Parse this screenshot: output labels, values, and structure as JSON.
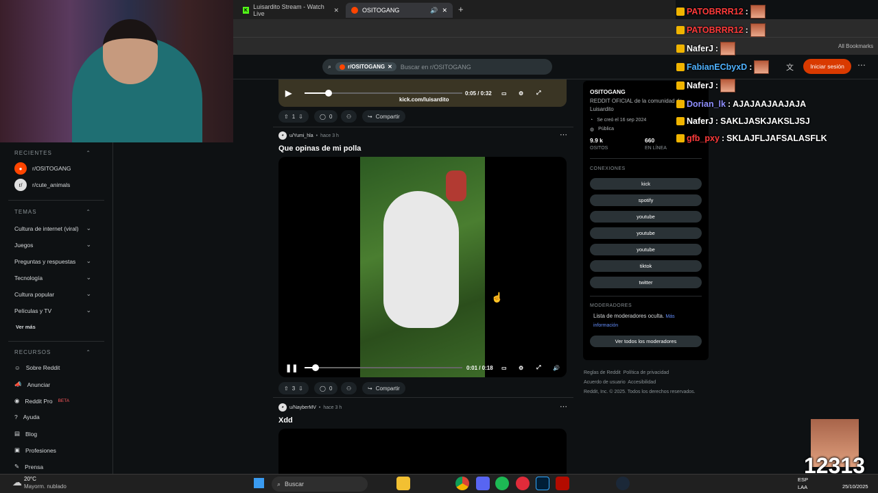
{
  "browser": {
    "tabs": [
      {
        "label": "Luisardito Stream - Watch Live"
      },
      {
        "label": "OSITOGANG"
      }
    ],
    "bookmarks_label": "All Bookmarks"
  },
  "reddit": {
    "search_chip": "r/OSITOGANG",
    "search_placeholder": "Buscar en r/OSITOGANG",
    "login_label": "Iniciar sesión"
  },
  "sidebar": {
    "recientes_title": "RECIENTES",
    "recientes": [
      {
        "label": "r/OSITOGANG"
      },
      {
        "label": "r/cute_animals"
      }
    ],
    "temas_title": "TEMAS",
    "temas": [
      {
        "label": "Cultura de internet (viral)"
      },
      {
        "label": "Juegos"
      },
      {
        "label": "Preguntas y respuestas"
      },
      {
        "label": "Tecnología"
      },
      {
        "label": "Cultura popular"
      },
      {
        "label": "Películas y TV"
      }
    ],
    "ver_mas": "Ver más",
    "recursos_title": "RECURSOS",
    "recursos": [
      {
        "label": "Sobre Reddit"
      },
      {
        "label": "Anunciar"
      },
      {
        "label": "Reddit Pro",
        "badge": "BETA"
      },
      {
        "label": "Ayuda"
      },
      {
        "label": "Blog"
      },
      {
        "label": "Profesiones"
      },
      {
        "label": "Prensa"
      }
    ]
  },
  "feed": {
    "post0": {
      "time": "0:05 / 0:32",
      "overlay_text": "kick.com/luisardito",
      "votes": "1",
      "comments": "0",
      "share": "Compartir"
    },
    "post1": {
      "author": "u/Yumi_hla",
      "ago": "hace 3 h",
      "title": "Que opinas de mi polla",
      "time": "0:01 / 0:18",
      "progress": 0.07,
      "votes": "3",
      "comments": "0",
      "share": "Compartir"
    },
    "post2": {
      "author": "u/NayberMV",
      "ago": "hace 3 h",
      "title": "Xdd"
    }
  },
  "community": {
    "name": "OSITOGANG",
    "desc": "REDDIT OFICIAL de la comunidad de Luisardito",
    "created": "Se creó el 16 sep 2024",
    "visibility": "Pública",
    "members": "9.9 k",
    "members_label": "OSITOS",
    "online": "660",
    "online_label": "EN LÍNEA",
    "connections_title": "CONEXIONES",
    "connections": [
      {
        "label": "kick"
      },
      {
        "label": "spotify"
      },
      {
        "label": "youtube"
      },
      {
        "label": "youtube"
      },
      {
        "label": "youtube"
      },
      {
        "label": "tiktok"
      },
      {
        "label": "twitter"
      }
    ],
    "mods_title": "MODERADORES",
    "mods_text": "Lista de moderadores oculta.",
    "mods_link": "Más información",
    "mods_button": "Ver todos los moderadores",
    "footer": [
      "Reglas de Reddit",
      "Política de privacidad",
      "Acuerdo de usuario",
      "Accesibilidad",
      "Reddit, Inc. © 2025. Todos los derechos reservados."
    ]
  },
  "chat": [
    {
      "user": "PATOBRRR12",
      "msg": "",
      "color": "#ff3b3b"
    },
    {
      "user": "PATOBRRR12",
      "msg": "",
      "color": "#ff3b3b"
    },
    {
      "user": "NaferJ",
      "msg": "",
      "color": "#ffffff"
    },
    {
      "user": "FabianECbyxD",
      "msg": "",
      "color": "#4fb2ff"
    },
    {
      "user": "NaferJ",
      "msg": "",
      "color": "#ffffff"
    },
    {
      "user": "Dorian_lk",
      "msg": "AJAJAAJAAJAJA",
      "color": "#8f8fff"
    },
    {
      "user": "NaferJ",
      "msg": "SAKLJASKJAKSLJSJ",
      "color": "#ffffff"
    },
    {
      "user": "gfb_pxy",
      "msg": "SKLAJFLJAFSALASFLK",
      "color": "#ff3b3b"
    }
  ],
  "overlay_counter": "12313",
  "taskbar": {
    "weather_temp": "20°C",
    "weather_desc": "Mayorm. nublado",
    "search": "Buscar",
    "lang": "ESP",
    "lang2": "LAA",
    "date": "25/10/2025"
  }
}
